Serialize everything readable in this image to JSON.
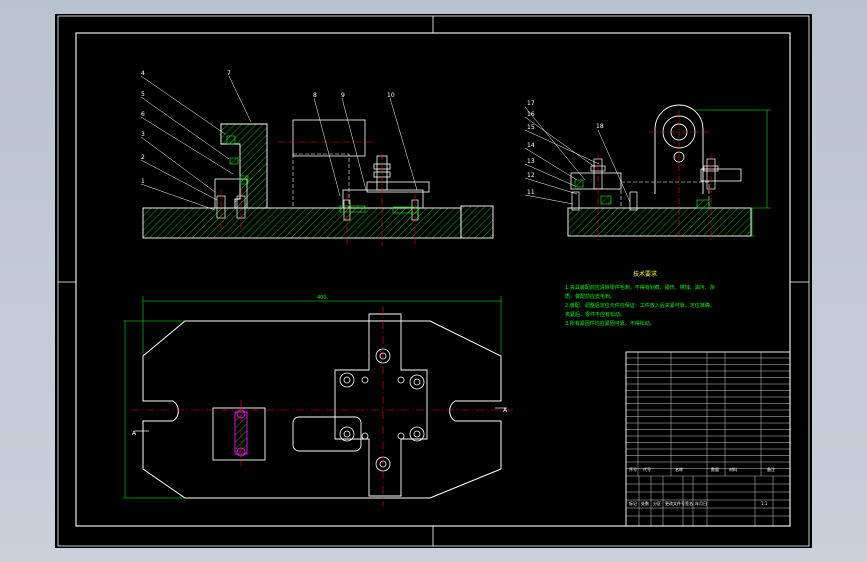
{
  "drawing": {
    "background": "#000000",
    "frame_color": "#ffffff",
    "part_color": "#ffffff",
    "hatch_color": "#00ff00",
    "centerline_color": "#ff0000",
    "dimension_color": "#00ff00",
    "highlight_color": "#ff00ff",
    "note_color": "#ffff00"
  },
  "front_view": {
    "balloons": [
      "4",
      "5",
      "6",
      "3",
      "2",
      "1",
      "7",
      "8",
      "9",
      "10"
    ]
  },
  "side_view": {
    "balloons": [
      "17",
      "16",
      "15",
      "14",
      "13",
      "12",
      "11",
      "18"
    ]
  },
  "plan_view": {
    "overall_dim": "400",
    "section_label": "A"
  },
  "notes": {
    "title": "技术要求",
    "lines": [
      "1.夹具装配前应清除零件毛刺，不得有划痕、碰伤、锈蚀、油污、杂",
      "质。装配前应去毛刺。",
      "2.装配、调整后定位元件应保证：工件放入后夹紧可靠，定位准确，",
      "夹紧后，零件不应有松动。",
      "3.所有紧固件均应紧固可靠，不得松动。"
    ]
  },
  "title_block": {
    "header": [
      "序号",
      "代号",
      "名称",
      "数量",
      "材料",
      "备注"
    ],
    "footer": [
      "标记",
      "处数",
      "分区",
      "更改文件号",
      "签名",
      "年月日"
    ],
    "scale": "1:1"
  }
}
